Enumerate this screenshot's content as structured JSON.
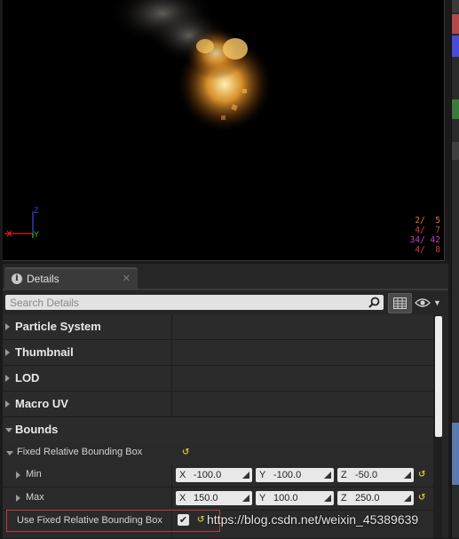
{
  "viewport": {
    "axis": {
      "z_label": "Z",
      "y_label": "Y"
    },
    "stats": [
      {
        "text": "2/  5",
        "color": "#d97a1e"
      },
      {
        "text": "4/  7",
        "color": "#d64040"
      },
      {
        "text": "34/ 42",
        "color": "#c040c0"
      },
      {
        "text": "4/  8",
        "color": "#d64040"
      }
    ]
  },
  "details": {
    "tab_label": "Details",
    "search_placeholder": "Search Details",
    "categories": [
      {
        "label": "Particle System",
        "expanded": false
      },
      {
        "label": "Thumbnail",
        "expanded": false
      },
      {
        "label": "LOD",
        "expanded": false
      },
      {
        "label": "Macro UV",
        "expanded": false
      },
      {
        "label": "Bounds",
        "expanded": true
      }
    ],
    "bounds": {
      "fixed_relative_label": "Fixed Relative Bounding Box",
      "min": {
        "label": "Min",
        "x_label": "X",
        "x": "-100.0",
        "y_label": "Y",
        "y": "-100.0",
        "z_label": "Z",
        "z": "-50.0"
      },
      "max": {
        "label": "Max",
        "x_label": "X",
        "x": "150.0",
        "y_label": "Y",
        "y": "100.0",
        "z_label": "Z",
        "z": "250.0"
      },
      "use_fixed_label": "Use Fixed Relative Bounding Box",
      "use_fixed_checked": true
    }
  },
  "watermark": "https://blog.csdn.net/weixin_45389639",
  "colors": {
    "accent_reset": "#d4c23a",
    "highlight_border": "#c0393b",
    "axis_x": "#e02020",
    "axis_y": "#20d020",
    "axis_z": "#3050e0"
  }
}
